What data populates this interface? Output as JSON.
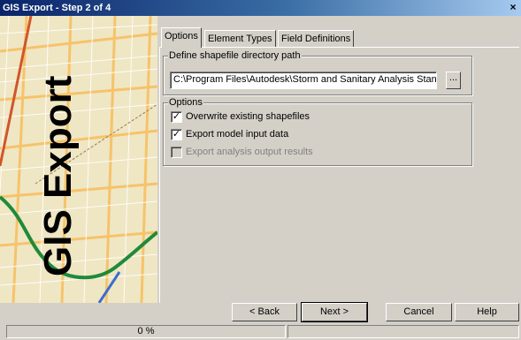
{
  "window": {
    "title": "GIS Export - Step 2 of 4",
    "close_glyph": "×"
  },
  "side_image": {
    "label": "GIS Export",
    "icon": "map-icon"
  },
  "tabs": [
    {
      "label": "Options",
      "active": true
    },
    {
      "label": "Element Types",
      "active": false
    },
    {
      "label": "Field Definitions",
      "active": false
    }
  ],
  "directory_group": {
    "legend": "Define shapefile directory path",
    "path_value": "C:\\Program Files\\Autodesk\\Storm and Sanitary Analysis Stan",
    "browse_label": "..."
  },
  "options_group": {
    "legend": "Options",
    "checkboxes": [
      {
        "label": "Overwrite existing shapefiles",
        "checked": true,
        "enabled": true
      },
      {
        "label": "Export model input data",
        "checked": true,
        "enabled": true
      },
      {
        "label": "Export analysis output results",
        "checked": false,
        "enabled": false
      }
    ],
    "check_glyph": "✓"
  },
  "buttons": {
    "back": "< Back",
    "next": "Next >",
    "cancel": "Cancel",
    "help": "Help"
  },
  "status": {
    "progress_text": "0 %",
    "progress_fraction": 0
  },
  "colors": {
    "title_start": "#0a246a",
    "title_end": "#a6caf0",
    "face": "#d4d0c8"
  }
}
